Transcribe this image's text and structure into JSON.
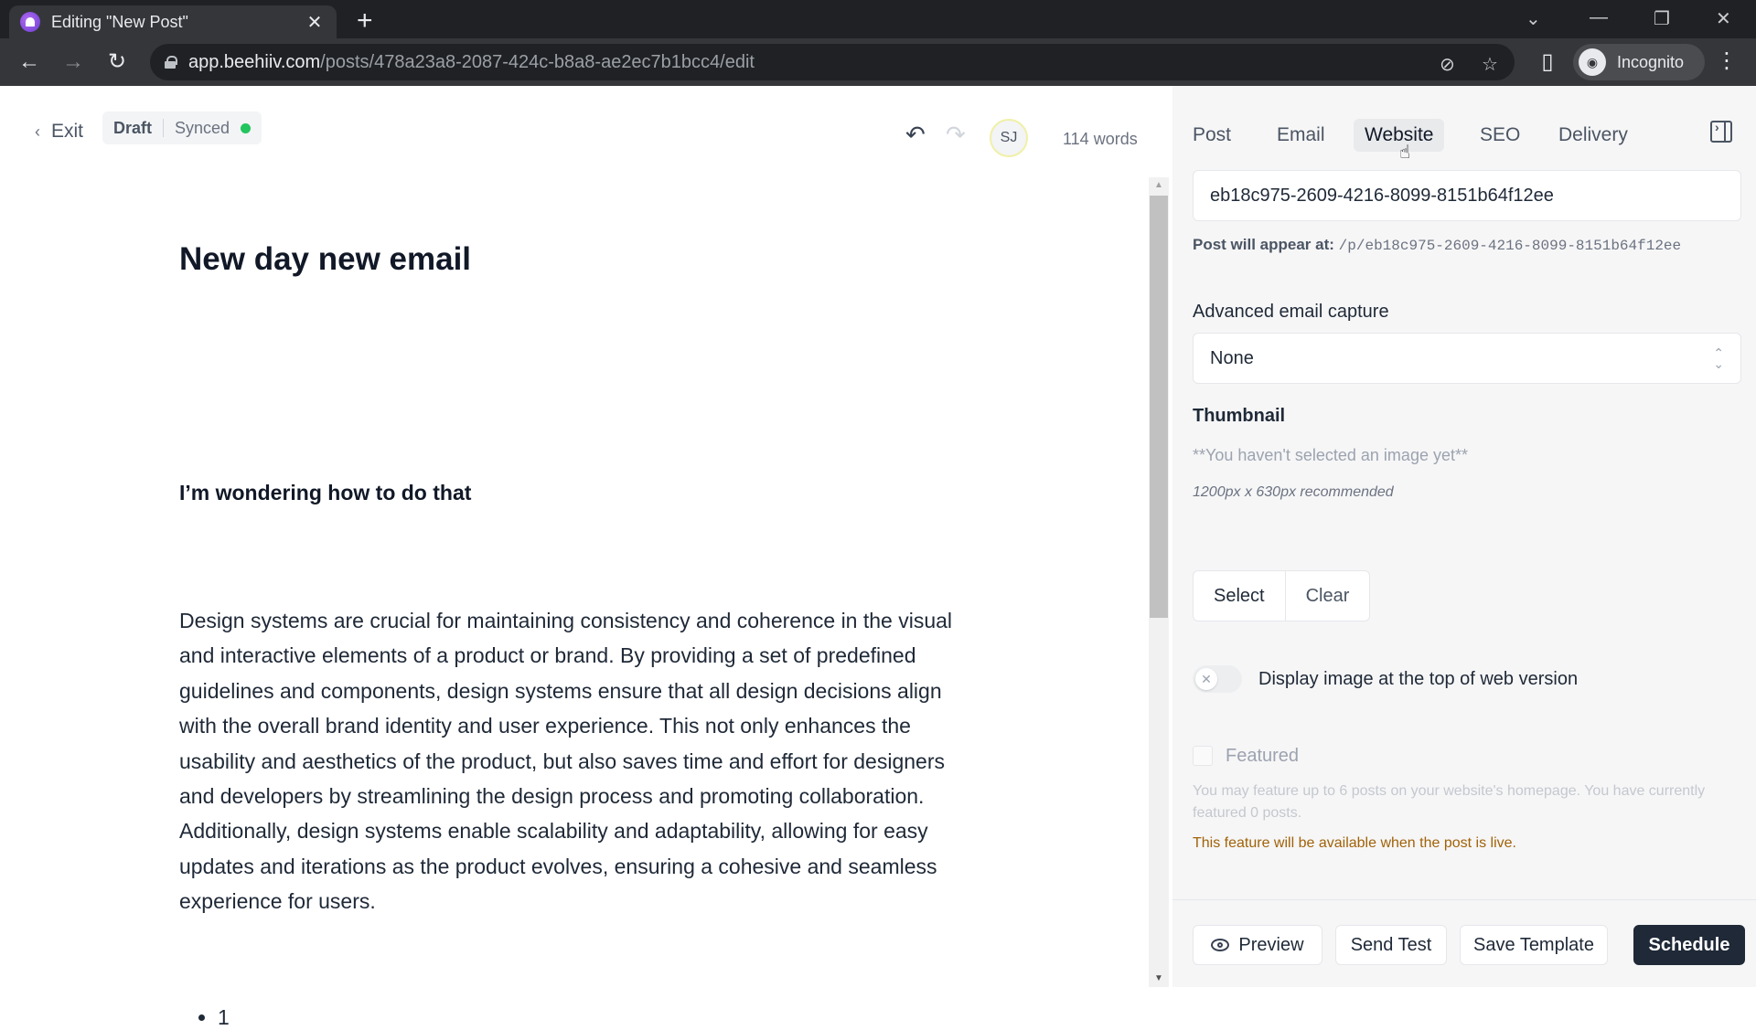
{
  "browser": {
    "tab_title": "Editing \"New Post\"",
    "url_host": "app.beehiiv.com",
    "url_path": "/posts/478a23a8-2087-424c-b8a8-ae2ec7b1bcc4/edit",
    "profile_label": "Incognito"
  },
  "editor": {
    "exit_label": "Exit",
    "status": "Draft",
    "sync_status": "Synced",
    "sync_color": "#22c55e",
    "avatar_initials": "SJ",
    "word_count": "114 words",
    "title": "New day new email",
    "subtitle": "I’m wondering how to do that",
    "body": "Design systems are crucial for maintaining consistency and coherence in the visual and interactive elements of a product or brand. By providing a set of predefined guidelines and components, design systems ensure that all design decisions align with the overall brand identity and user experience. This not only enhances the usability and aesthetics of the product, but also saves time and effort for designers and developers by streamlining the design process and promoting collaboration. Additionally, design systems enable scalability and adaptability, allowing for easy updates and iterations as the product evolves, ensuring a cohesive and seamless experience for users.",
    "list_items": [
      "1"
    ]
  },
  "panel": {
    "tabs": [
      {
        "label": "Post",
        "active": false
      },
      {
        "label": "Email",
        "active": false
      },
      {
        "label": "Website",
        "active": true
      },
      {
        "label": "SEO",
        "active": false
      },
      {
        "label": "Delivery",
        "active": false
      }
    ],
    "slug_value": "eb18c975-2609-4216-8099-8151b64f12ee",
    "appear_at_label": "Post will appear at:",
    "appear_at_path": "/p/eb18c975-2609-4216-8099-8151b64f12ee",
    "email_capture_label": "Advanced email capture",
    "email_capture_value": "None",
    "thumbnail_label": "Thumbnail",
    "thumbnail_empty": "**You haven't selected an image yet**",
    "thumbnail_hint": "1200px x 630px recommended",
    "select_label": "Select",
    "clear_label": "Clear",
    "display_image_label": "Display image at the top of web version",
    "display_image_on": false,
    "featured_label": "Featured",
    "featured_checked": false,
    "featured_help": "You may feature up to 6 posts on your website's homepage. You have currently featured 0 posts.",
    "featured_warning": "This feature will be available when the post is live.",
    "footer": {
      "preview_label": "Preview",
      "send_test_label": "Send Test",
      "save_template_label": "Save Template",
      "schedule_label": "Schedule"
    }
  }
}
